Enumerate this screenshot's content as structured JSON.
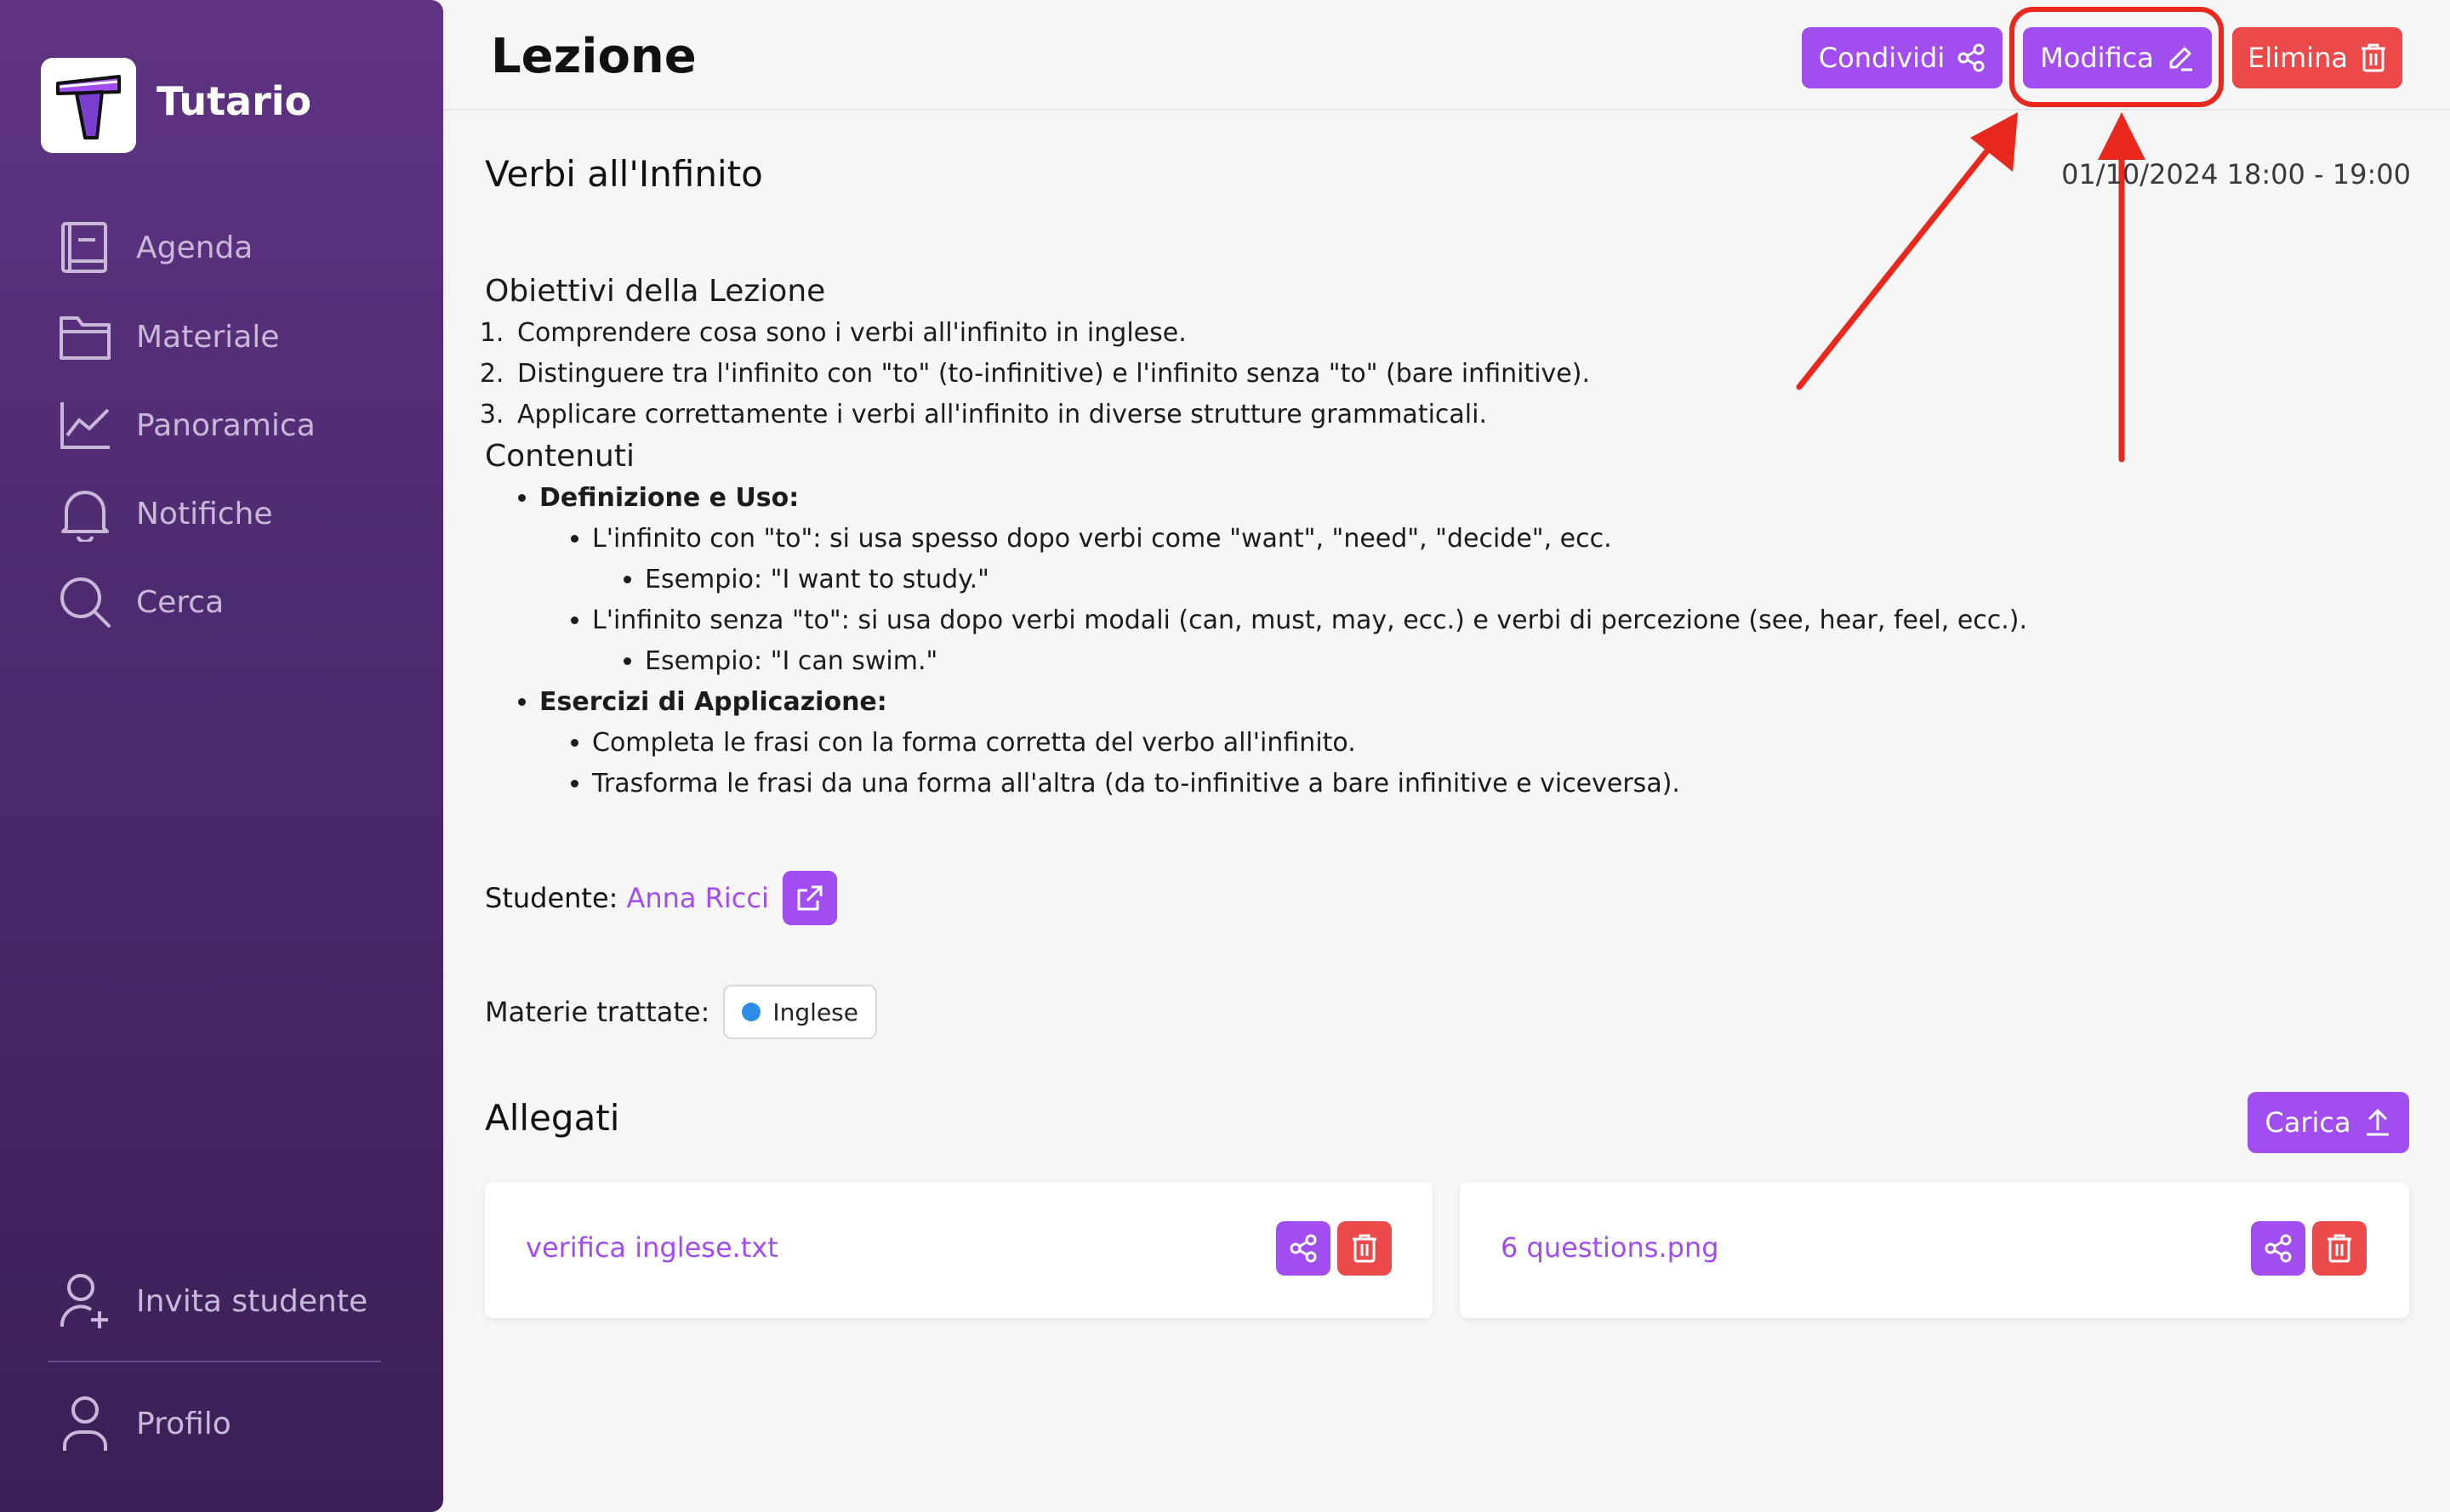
{
  "app": {
    "name": "Tutario"
  },
  "sidebar": {
    "items": [
      {
        "label": "Agenda",
        "icon": "book-icon"
      },
      {
        "label": "Materiale",
        "icon": "folder-icon"
      },
      {
        "label": "Panoramica",
        "icon": "chart-line-icon"
      },
      {
        "label": "Notifiche",
        "icon": "bell-icon"
      },
      {
        "label": "Cerca",
        "icon": "search-icon"
      }
    ],
    "invite": {
      "label": "Invita studente",
      "icon": "user-plus-icon"
    },
    "profile": {
      "label": "Profilo",
      "icon": "user-icon"
    }
  },
  "header": {
    "title": "Lezione",
    "share_label": "Condividi",
    "edit_label": "Modifica",
    "delete_label": "Elimina"
  },
  "lesson": {
    "title": "Verbi all'Infinito",
    "datetime": "01/10/2024 18:00 - 19:00",
    "objectives_heading": "Obiettivi della Lezione",
    "objectives": [
      "Comprendere cosa sono i verbi all'infinito in inglese.",
      "Distinguere tra l'infinito con \"to\" (to-infinitive) e l'infinito senza \"to\" (bare infinitive).",
      "Applicare correttamente i verbi all'infinito in diverse strutture grammaticali."
    ],
    "contents_heading": "Contenuti",
    "sections": [
      {
        "title": "Definizione e Uso:",
        "points": [
          {
            "text": "L'infinito con \"to\": si usa spesso dopo verbi come \"want\", \"need\", \"decide\", ecc.",
            "example": "Esempio: \"I want to study.\""
          },
          {
            "text": "L'infinito senza \"to\": si usa dopo verbi modali (can, must, may, ecc.) e verbi di percezione (see, hear, feel, ecc.).",
            "example": "Esempio: \"I can swim.\""
          }
        ]
      },
      {
        "title": "Esercizi di Applicazione:",
        "points": [
          {
            "text": "Completa le frasi con la forma corretta del verbo all'infinito."
          },
          {
            "text": "Trasforma le frasi da una forma all'altra (da to-infinitive a bare infinitive e viceversa)."
          }
        ]
      }
    ],
    "student_label": "Studente:",
    "student_name": "Anna Ricci",
    "subjects_label": "Materie trattate:",
    "subject": {
      "name": "Inglese",
      "color": "#2f8be8"
    }
  },
  "attachments": {
    "title": "Allegati",
    "upload_label": "Carica",
    "files": [
      {
        "name": "verifica inglese.txt"
      },
      {
        "name": "6 questions.png"
      }
    ]
  },
  "colors": {
    "accent": "#a24df0",
    "danger": "#ec4a4a",
    "annotation": "#e8281c"
  }
}
